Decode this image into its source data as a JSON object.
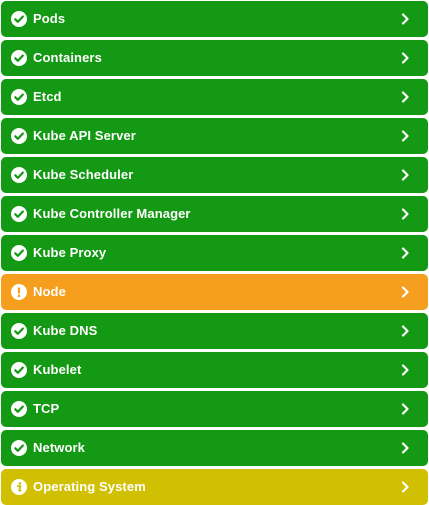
{
  "colors": {
    "ok": "#139913",
    "warning": "#f69e1e",
    "info": "#d1c001",
    "text": "#ffffff"
  },
  "checks": [
    {
      "label": "Pods",
      "status": "ok",
      "icon": "check-circle-icon"
    },
    {
      "label": "Containers",
      "status": "ok",
      "icon": "check-circle-icon"
    },
    {
      "label": "Etcd",
      "status": "ok",
      "icon": "check-circle-icon"
    },
    {
      "label": "Kube API Server",
      "status": "ok",
      "icon": "check-circle-icon"
    },
    {
      "label": "Kube Scheduler",
      "status": "ok",
      "icon": "check-circle-icon"
    },
    {
      "label": "Kube Controller Manager",
      "status": "ok",
      "icon": "check-circle-icon"
    },
    {
      "label": "Kube Proxy",
      "status": "ok",
      "icon": "check-circle-icon"
    },
    {
      "label": "Node",
      "status": "warning",
      "icon": "exclamation-circle-icon"
    },
    {
      "label": "Kube DNS",
      "status": "ok",
      "icon": "check-circle-icon"
    },
    {
      "label": "Kubelet",
      "status": "ok",
      "icon": "check-circle-icon"
    },
    {
      "label": "TCP",
      "status": "ok",
      "icon": "check-circle-icon"
    },
    {
      "label": "Network",
      "status": "ok",
      "icon": "check-circle-icon"
    },
    {
      "label": "Operating System",
      "status": "info",
      "icon": "info-circle-icon"
    }
  ]
}
